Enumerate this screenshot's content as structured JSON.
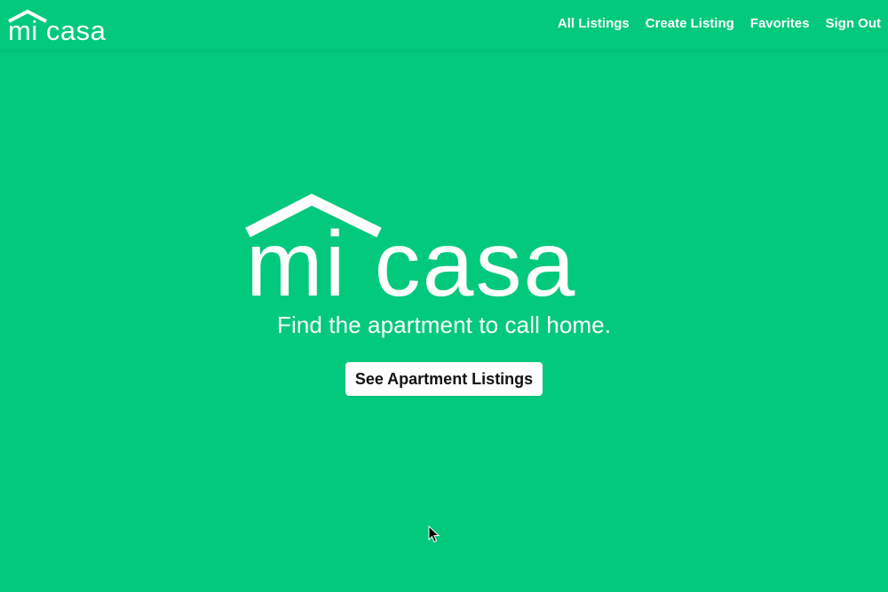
{
  "brand": {
    "logo_text": "mi casa",
    "logo_icon": "house-roof-icon"
  },
  "nav": {
    "items": [
      {
        "label": "All Listings"
      },
      {
        "label": "Create Listing"
      },
      {
        "label": "Favorites"
      },
      {
        "label": "Sign Out"
      }
    ]
  },
  "hero": {
    "logo_text": "mi casa",
    "tagline": "Find the apartment to call home.",
    "cta_label": "See Apartment Listings"
  },
  "colors": {
    "background": "#02c97c",
    "text": "#ffffff",
    "button_bg": "#ffffff",
    "button_text": "#111111"
  },
  "cursor": {
    "icon": "mouse-pointer-icon"
  }
}
